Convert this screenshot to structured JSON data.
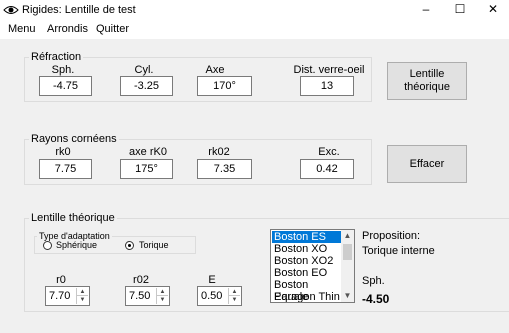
{
  "window": {
    "title": "Rigides: Lentille de test",
    "minimize_glyph": "–",
    "maximize_glyph": "☐",
    "close_glyph": "✕"
  },
  "menu": {
    "items": [
      "Menu",
      "Arrondis",
      "Quitter"
    ]
  },
  "refraction": {
    "legend": "Réfraction",
    "labels": {
      "sph": "Sph.",
      "cyl": "Cyl.",
      "axe": "Axe",
      "dist": "Dist. verre-oeil"
    },
    "values": {
      "sph": "-4.75",
      "cyl": "-3.25",
      "axe": "170°",
      "dist": "13"
    }
  },
  "rayons": {
    "legend": "Rayons cornéens",
    "labels": {
      "rk0": "rk0",
      "axe_rk0": "axe rK0",
      "rk02": "rk02",
      "exc": "Exc."
    },
    "values": {
      "rk0": "7.75",
      "axe_rk0": "175°",
      "rk02": "7.35",
      "exc": "0.42"
    }
  },
  "buttons": {
    "lentille_line1": "Lentille",
    "lentille_line2": "théorique",
    "effacer": "Effacer"
  },
  "lentille": {
    "legend": "Lentille théorique",
    "adaptation": {
      "legend": "Type d'adaptation",
      "options": [
        "Sphérique",
        "Torique"
      ],
      "selected": "Torique"
    },
    "labels": {
      "r0": "r0",
      "r02": "r02",
      "e": "E"
    },
    "values": {
      "r0": "7.70",
      "r02": "7.50",
      "e": "0.50"
    }
  },
  "lens_list": {
    "items": [
      "Boston ES",
      "Boston XO",
      "Boston XO2",
      "Boston EO",
      "Boston Equale",
      "Paragon Thin"
    ],
    "selected": "Boston ES"
  },
  "proposition": {
    "label": "Proposition:",
    "value": "Torique interne",
    "sph_label": "Sph.",
    "sph_value": "-4.50"
  }
}
